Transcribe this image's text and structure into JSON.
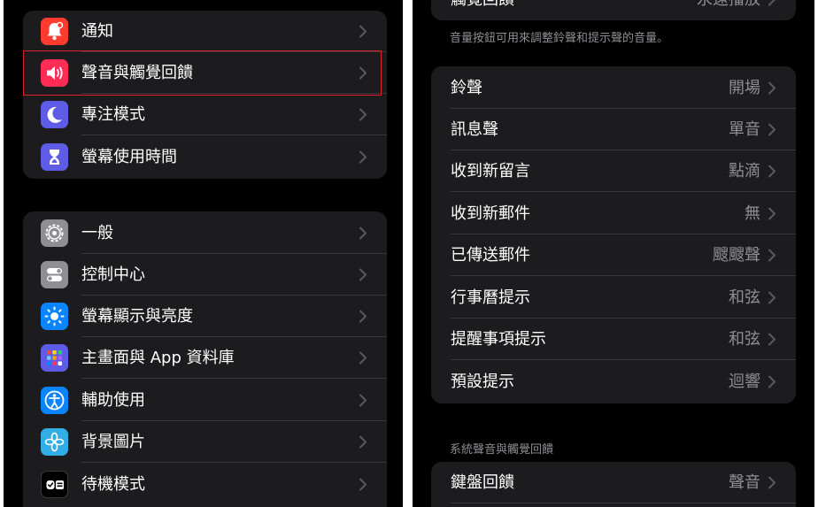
{
  "left_panel": {
    "group1": [
      {
        "label": "通知",
        "icon": "bell-icon",
        "color": "#ff3b30"
      },
      {
        "label": "聲音與觸覺回饋",
        "icon": "speaker-icon",
        "color": "#ff2d55"
      },
      {
        "label": "專注模式",
        "icon": "moon-icon",
        "color": "#5e5ce6"
      },
      {
        "label": "螢幕使用時間",
        "icon": "hourglass-icon",
        "color": "#5e5ce6"
      }
    ],
    "group2": [
      {
        "label": "一般",
        "icon": "gear-icon",
        "color": "#8e8e93"
      },
      {
        "label": "控制中心",
        "icon": "toggles-icon",
        "color": "#8e8e93"
      },
      {
        "label": "螢幕顯示與亮度",
        "icon": "sun-icon",
        "color": "#0a84ff"
      },
      {
        "label": "主畫面與 App 資料庫",
        "icon": "app-grid-icon",
        "color": "#5e5ce6"
      },
      {
        "label": "輔助使用",
        "icon": "accessibility-icon",
        "color": "#0a84ff"
      },
      {
        "label": "背景圖片",
        "icon": "flower-icon",
        "color": "#32ade6"
      },
      {
        "label": "待機模式",
        "icon": "standby-icon",
        "color": "#1c1c1e"
      }
    ]
  },
  "right_panel": {
    "top_row": {
      "label": "觸覺回饋",
      "value": "永遠播放"
    },
    "footnote": "音量按鈕可用來調整鈴聲和提示聲的音量。",
    "sounds": [
      {
        "label": "鈴聲",
        "value": "開場"
      },
      {
        "label": "訊息聲",
        "value": "單音"
      },
      {
        "label": "收到新留言",
        "value": "點滴"
      },
      {
        "label": "收到新郵件",
        "value": "無"
      },
      {
        "label": "已傳送郵件",
        "value": "颼颼聲"
      },
      {
        "label": "行事曆提示",
        "value": "和弦"
      },
      {
        "label": "提醒事項提示",
        "value": "和弦"
      },
      {
        "label": "預設提示",
        "value": "迴響"
      }
    ],
    "section_header": "系統聲音與觸覺回饋",
    "system": [
      {
        "label": "鍵盤回饋",
        "value": "聲音"
      }
    ]
  },
  "colors": {
    "background": "#000000",
    "group_background": "#1c1c1e",
    "separator": "#38383a",
    "secondary_text": "#8e8e93",
    "selection_outline": "#e0202a"
  }
}
